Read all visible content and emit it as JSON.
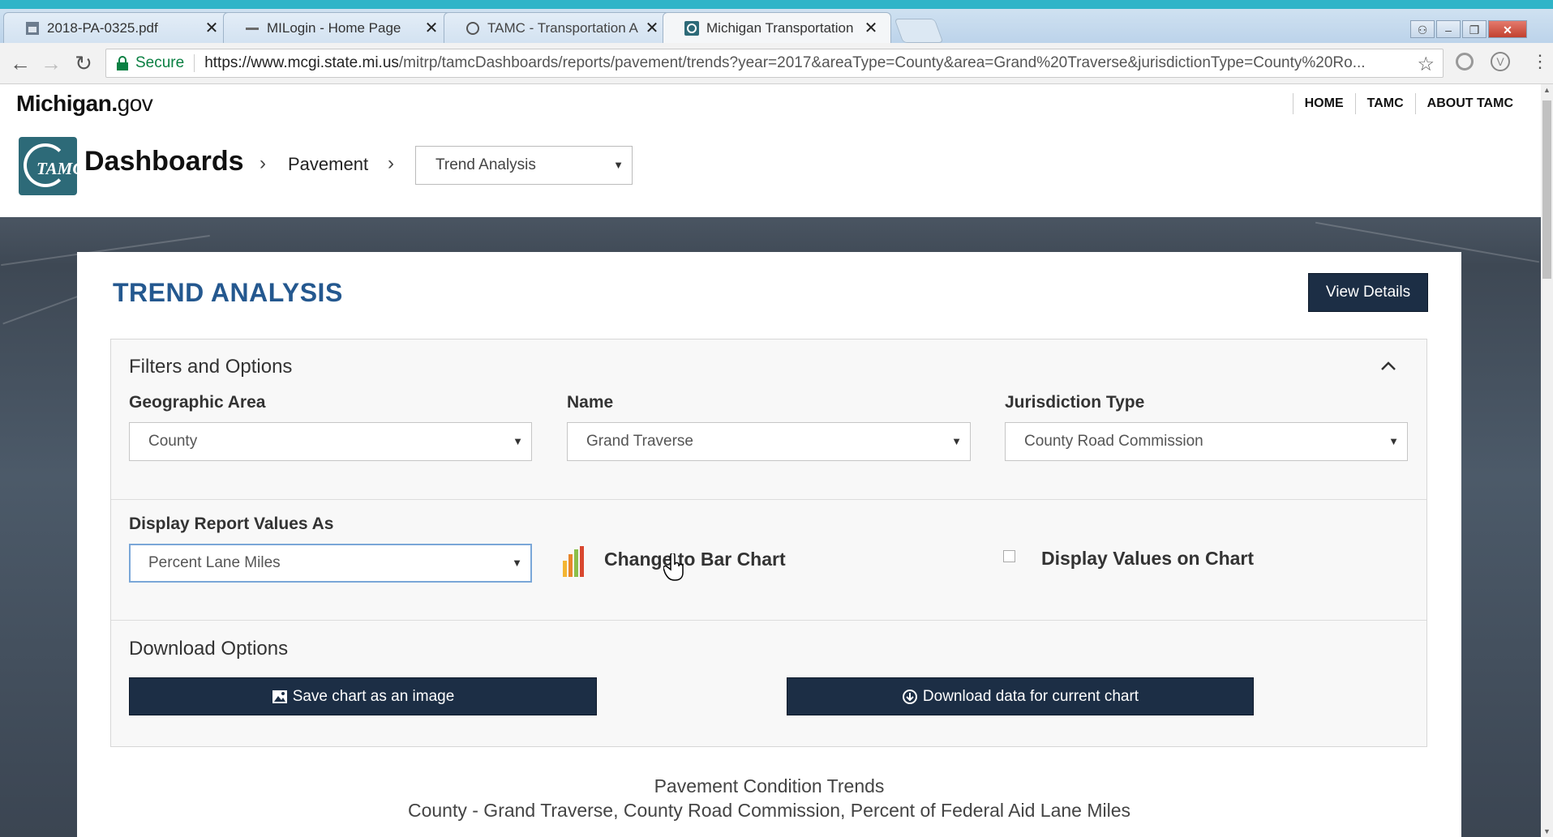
{
  "browser": {
    "tabs": [
      {
        "title": "2018-PA-0325.pdf",
        "favicon": "pdf-icon",
        "active": false
      },
      {
        "title": "MILogin - Home Page",
        "favicon": "milogin-icon",
        "active": false
      },
      {
        "title": "TAMC - Transportation A",
        "favicon": "tamc-icon",
        "active": false
      },
      {
        "title": "Michigan Transportation",
        "favicon": "michigan-icon",
        "active": true
      }
    ],
    "secure_label": "Secure",
    "url_host": "https://www.mcgi.state.mi.us",
    "url_path": "/mitrp/tamcDashboards/reports/pavement/trends?year=2017&areaType=County&area=Grand%20Traverse&jurisdictionType=County%20Ro..."
  },
  "site": {
    "logo_bold": "Michigan.",
    "logo_light": "gov",
    "nav": [
      "HOME",
      "TAMC",
      "ABOUT TAMC"
    ]
  },
  "breadcrumb": {
    "logo_text": "TAMC",
    "title": "Dashboards",
    "item": "Pavement",
    "select_value": "Trend Analysis"
  },
  "main": {
    "title": "TREND ANALYSIS",
    "view_details_label": "View Details",
    "filters": {
      "section_title": "Filters and Options",
      "geo_label": "Geographic Area",
      "geo_value": "County",
      "name_label": "Name",
      "name_value": "Grand Traverse",
      "jurisdiction_label": "Jurisdiction Type",
      "jurisdiction_value": "County Road Commission",
      "display_label": "Display Report Values As",
      "display_value": "Percent Lane Miles",
      "bar_chart_label": "Change to Bar Chart",
      "display_values_label": "Display Values on Chart",
      "display_values_checked": false
    },
    "download": {
      "section_title": "Download Options",
      "save_image_label": "Save chart as an image",
      "download_data_label": "Download data for current chart"
    },
    "chart_title": "Pavement Condition Trends",
    "chart_subtitle": "County - Grand Traverse, County Road Commission, Percent of Federal Aid Lane Miles"
  },
  "colors": {
    "accent": "#2fb4c8",
    "title_blue": "#24588f",
    "button_navy": "#1c2e45"
  }
}
